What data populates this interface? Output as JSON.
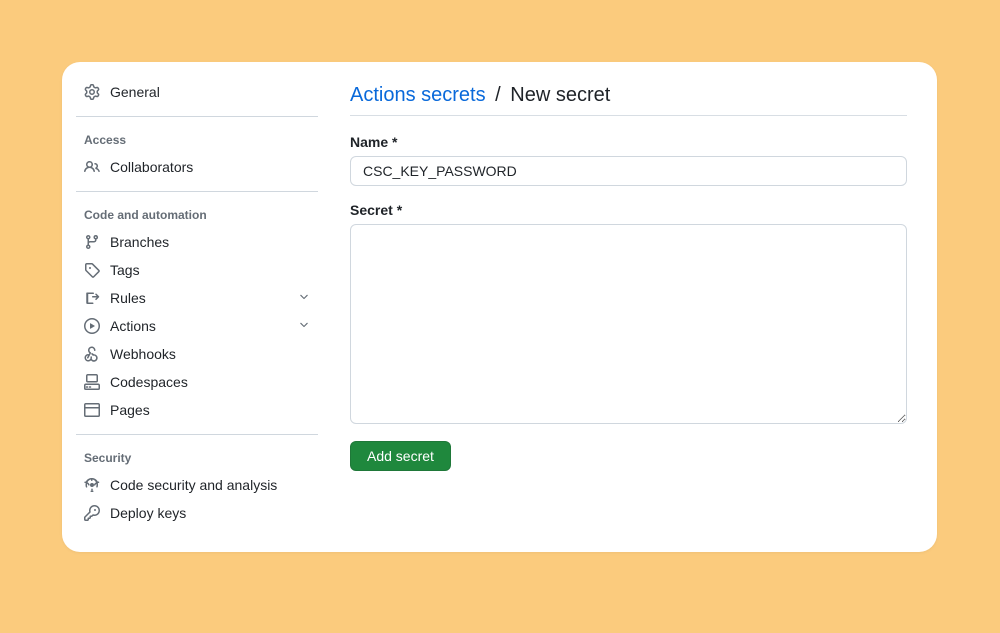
{
  "sidebar": {
    "general": {
      "label": "General"
    },
    "sections": {
      "access": {
        "header": "Access",
        "items": [
          {
            "key": "collaborators",
            "label": "Collaborators",
            "icon": "people-icon"
          }
        ]
      },
      "code": {
        "header": "Code and automation",
        "items": [
          {
            "key": "branches",
            "label": "Branches",
            "icon": "branch-icon"
          },
          {
            "key": "tags",
            "label": "Tags",
            "icon": "tag-icon"
          },
          {
            "key": "rules",
            "label": "Rules",
            "icon": "rules-icon",
            "expandable": true
          },
          {
            "key": "actions",
            "label": "Actions",
            "icon": "play-icon",
            "expandable": true
          },
          {
            "key": "webhooks",
            "label": "Webhooks",
            "icon": "webhook-icon"
          },
          {
            "key": "codespaces",
            "label": "Codespaces",
            "icon": "codespaces-icon"
          },
          {
            "key": "pages",
            "label": "Pages",
            "icon": "browser-icon"
          }
        ]
      },
      "security": {
        "header": "Security",
        "items": [
          {
            "key": "code-security",
            "label": "Code security and analysis",
            "icon": "analysis-icon"
          },
          {
            "key": "deploy-keys",
            "label": "Deploy keys",
            "icon": "key-icon"
          }
        ]
      }
    }
  },
  "main": {
    "breadcrumb_link": "Actions secrets",
    "breadcrumb_sep": "/",
    "breadcrumb_current": "New secret",
    "name_label": "Name *",
    "name_value": "CSC_KEY_PASSWORD",
    "secret_label": "Secret *",
    "secret_value": "",
    "submit_label": "Add secret"
  }
}
